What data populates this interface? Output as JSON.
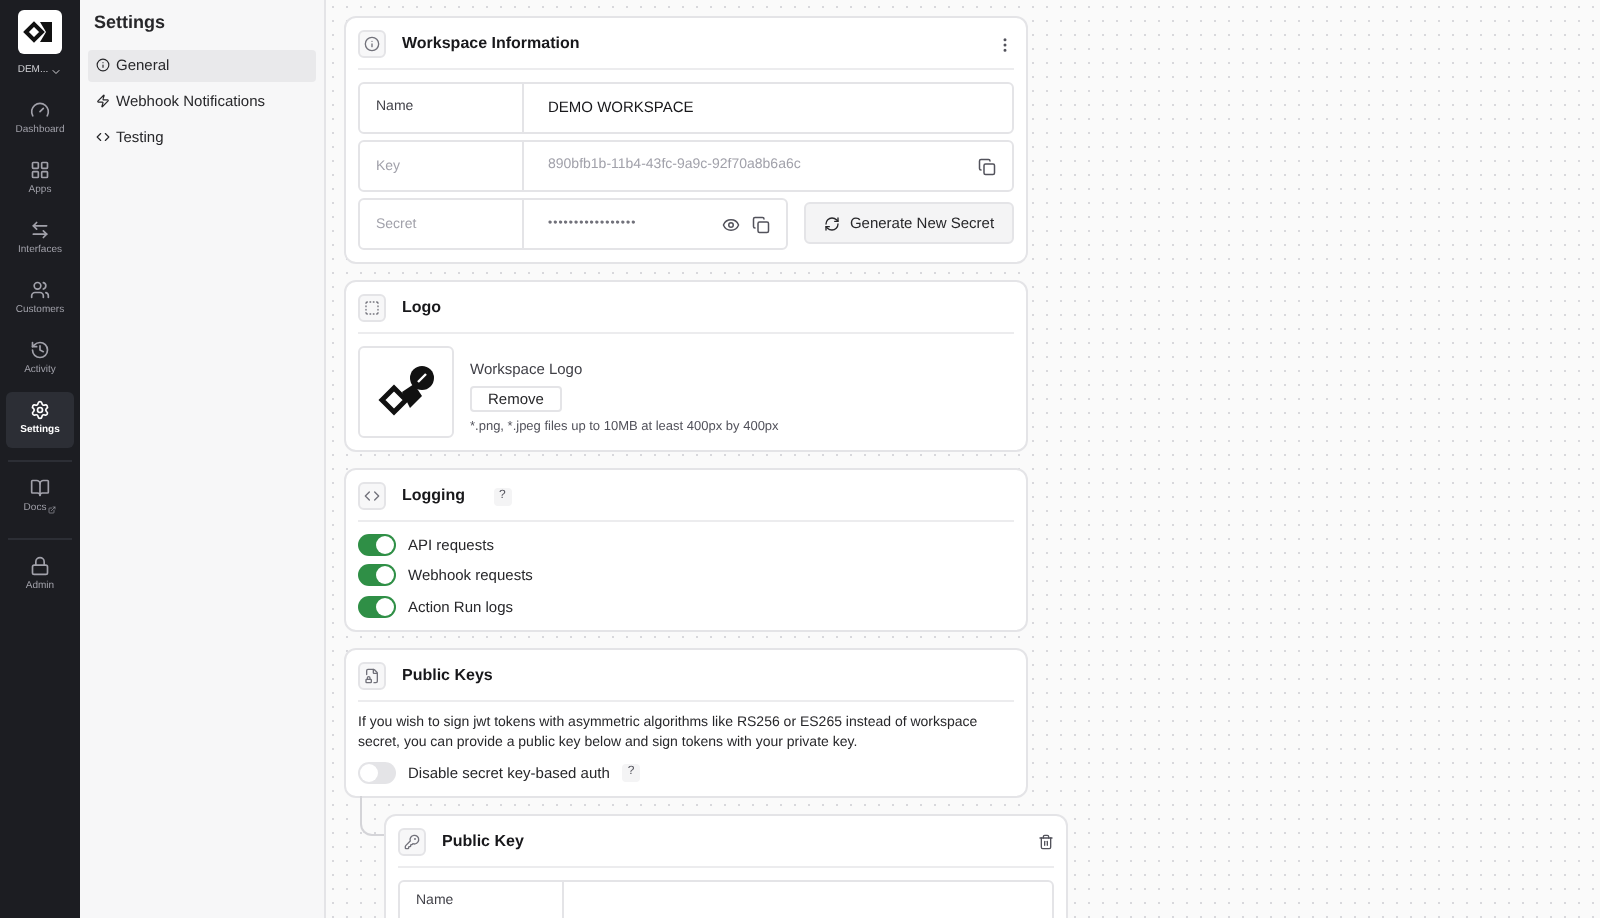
{
  "workspace_switcher": {
    "label": "DEM..."
  },
  "nav": [
    {
      "kind": "dashboard",
      "label": "Dashboard",
      "selected": false
    },
    {
      "kind": "apps",
      "label": "Apps",
      "selected": false
    },
    {
      "kind": "interfaces",
      "label": "Interfaces",
      "selected": false
    },
    {
      "kind": "customers",
      "label": "Customers",
      "selected": false
    },
    {
      "kind": "activity",
      "label": "Activity",
      "selected": false
    },
    {
      "kind": "settings",
      "label": "Settings",
      "selected": true
    },
    {
      "kind": "docs",
      "label": "Docs",
      "selected": false
    },
    {
      "kind": "admin",
      "label": "Admin",
      "selected": false
    }
  ],
  "settings_menu": {
    "title": "Settings",
    "items": [
      {
        "kind": "info",
        "label": "General",
        "selected": true
      },
      {
        "kind": "zap",
        "label": "Webhook Notifications",
        "selected": false
      },
      {
        "kind": "code",
        "label": "Testing",
        "selected": false
      }
    ]
  },
  "workspace_information": {
    "title": "Workspace Information",
    "name_label": "Name",
    "name_value": "DEMO WORKSPACE",
    "key_label": "Key",
    "key_value": "890bfb1b-11b4-43fc-9a9c-92f70a8b6a6c",
    "secret_label": "Secret",
    "secret_value": "•••••••••••••••••",
    "generate_button": "Generate New Secret"
  },
  "logo": {
    "title": "Logo",
    "label": "Workspace Logo",
    "remove_button": "Remove",
    "hint": "*.png, *.jpeg files up to 10MB at least 400px by 400px"
  },
  "logging": {
    "title": "Logging",
    "help": "?",
    "toggles": [
      {
        "label": "API requests",
        "on": true
      },
      {
        "label": "Webhook requests",
        "on": true
      },
      {
        "label": "Action Run logs",
        "on": true
      }
    ]
  },
  "public_keys": {
    "title": "Public Keys",
    "description": "If you wish to sign jwt tokens with asymmetric algorithms like RS256 or ES265 instead of workspace secret, you can provide a public key below and sign tokens with your private key.",
    "toggle": {
      "label": "Disable secret key-based auth",
      "on": false
    },
    "help": "?"
  },
  "public_key": {
    "title": "Public Key",
    "name_label": "Name"
  }
}
